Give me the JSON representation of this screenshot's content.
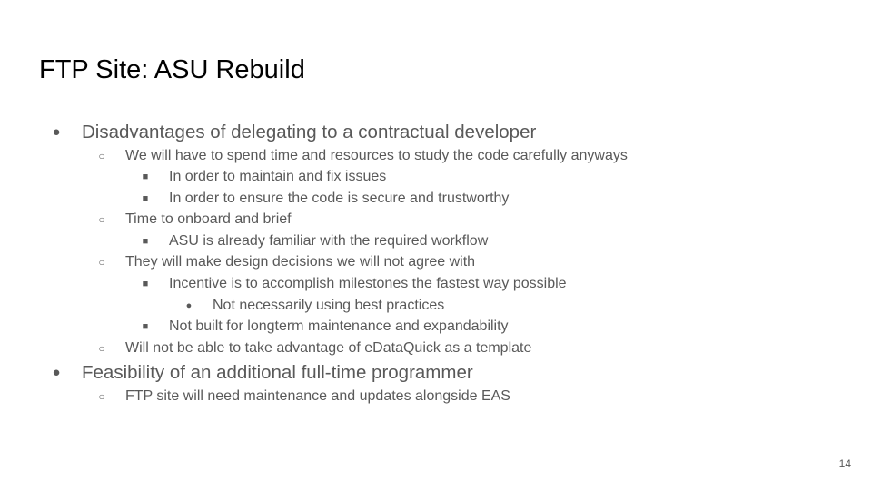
{
  "slide": {
    "title": "FTP Site: ASU Rebuild",
    "page_number": "14",
    "bullets": {
      "level1_marker": "●",
      "level2_marker": "○",
      "level3_marker": "■",
      "level4_marker": "●"
    },
    "items": [
      {
        "level": 1,
        "text": "Disadvantages of delegating to a contractual developer"
      },
      {
        "level": 2,
        "text": "We will have to spend time and resources to study the code carefully anyways"
      },
      {
        "level": 3,
        "text": "In order to maintain and fix issues"
      },
      {
        "level": 3,
        "text": "In order to ensure the code is secure and trustworthy"
      },
      {
        "level": 2,
        "text": "Time to onboard and brief"
      },
      {
        "level": 3,
        "text": "ASU is already familiar with the required workflow"
      },
      {
        "level": 2,
        "text": "They will make design decisions we will not agree with"
      },
      {
        "level": 3,
        "text": "Incentive is to accomplish milestones the fastest way possible"
      },
      {
        "level": 4,
        "text": "Not necessarily using best practices"
      },
      {
        "level": 3,
        "text": "Not built for longterm maintenance and expandability"
      },
      {
        "level": 2,
        "text": "Will not be able to take advantage of eDataQuick as a template"
      },
      {
        "level": 1,
        "text": "Feasibility of an additional full-time programmer"
      },
      {
        "level": 2,
        "text": "FTP site will need maintenance and updates alongside EAS"
      }
    ]
  }
}
